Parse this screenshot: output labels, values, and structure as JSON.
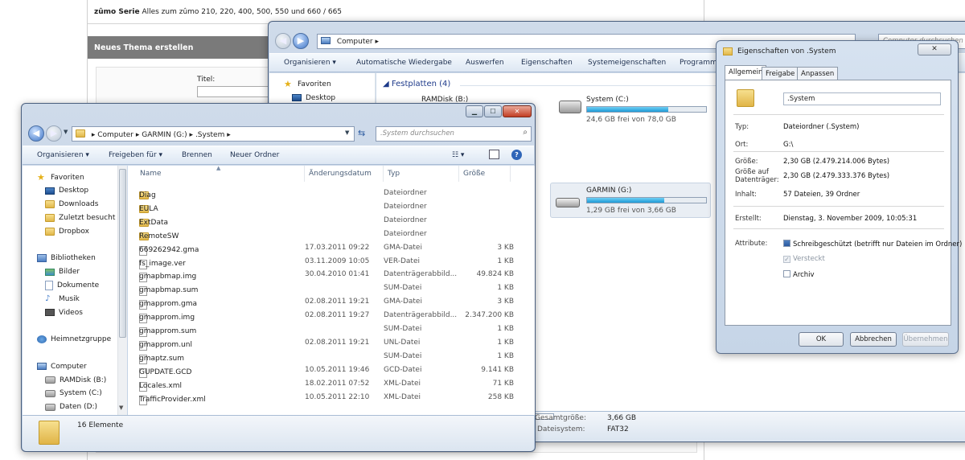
{
  "web": {
    "series_title": "zûmo Serie",
    "series_sub": "Alles zum zûmo 210, 220, 400, 500, 550 und 660 / 665",
    "thema_bar": "Neues Thema erstellen",
    "titel_label": "Titel:"
  },
  "computer_win": {
    "breadcrumb": "Computer",
    "search_placeholder": "Computer durchsuchen",
    "toolbar": [
      "Organisieren ▾",
      "Automatische Wiedergabe",
      "Auswerfen",
      "Eigenschaften",
      "Systemeigenschaften",
      "Programm"
    ],
    "nav": [
      {
        "label": "Favoriten",
        "icon": "star-icon"
      },
      {
        "label": "Desktop",
        "icon": "desktop-icon"
      }
    ],
    "group_title": "Festplatten (4)",
    "drives": [
      {
        "name": "RAMDisk (B:)",
        "free": "",
        "fill": 0.0
      },
      {
        "name": "System (C:)",
        "free": "24,6 GB frei von 78,0 GB",
        "fill": 0.68
      },
      {
        "name": "GARMIN (G:)",
        "free": "1,29 GB frei von 3,66 GB",
        "fill": 0.65
      }
    ],
    "details": {
      "gesamt_label": "Gesamtgröße:",
      "gesamt_value": "3,66 GB",
      "fs_label": "Dateisystem:",
      "fs_value": "FAT32"
    }
  },
  "main_win": {
    "breadcrumb": [
      "Computer",
      "GARMIN (G:)",
      ".System"
    ],
    "search_placeholder": ".System durchsuchen",
    "toolbar": [
      "Organisieren ▾",
      "Freigeben für ▾",
      "Brennen",
      "Neuer Ordner"
    ],
    "nav": [
      {
        "label": "Favoriten",
        "icon": "star",
        "indent": 0
      },
      {
        "label": "Desktop",
        "icon": "desk",
        "indent": 1
      },
      {
        "label": "Downloads",
        "icon": "folder",
        "indent": 1
      },
      {
        "label": "Zuletzt besucht",
        "icon": "folder",
        "indent": 1
      },
      {
        "label": "Dropbox",
        "icon": "folder",
        "indent": 1
      },
      {
        "label": "",
        "icon": "",
        "indent": 0
      },
      {
        "label": "Bibliotheken",
        "icon": "lib",
        "indent": 0
      },
      {
        "label": "Bilder",
        "icon": "pic",
        "indent": 1
      },
      {
        "label": "Dokumente",
        "icon": "doc",
        "indent": 1
      },
      {
        "label": "Musik",
        "icon": "music",
        "indent": 1
      },
      {
        "label": "Videos",
        "icon": "vid",
        "indent": 1
      },
      {
        "label": "",
        "icon": "",
        "indent": 0
      },
      {
        "label": "Heimnetzgruppe",
        "icon": "net",
        "indent": 0
      },
      {
        "label": "",
        "icon": "",
        "indent": 0
      },
      {
        "label": "Computer",
        "icon": "comp",
        "indent": 0
      },
      {
        "label": "RAMDisk (B:)",
        "icon": "disk",
        "indent": 1
      },
      {
        "label": "System (C:)",
        "icon": "disk",
        "indent": 1
      },
      {
        "label": "Daten (D:)",
        "icon": "disk",
        "indent": 1
      }
    ],
    "columns": [
      "Name",
      "Änderungsdatum",
      "Typ",
      "Größe"
    ],
    "files": [
      {
        "name": "Diag",
        "date": "",
        "type": "Dateiordner",
        "size": "",
        "folder": true
      },
      {
        "name": "EULA",
        "date": "",
        "type": "Dateiordner",
        "size": "",
        "folder": true
      },
      {
        "name": "ExtData",
        "date": "",
        "type": "Dateiordner",
        "size": "",
        "folder": true
      },
      {
        "name": "RemoteSW",
        "date": "",
        "type": "Dateiordner",
        "size": "",
        "folder": true
      },
      {
        "name": "669262942.gma",
        "date": "17.03.2011 09:22",
        "type": "GMA-Datei",
        "size": "3 KB",
        "folder": false
      },
      {
        "name": "fs_image.ver",
        "date": "03.11.2009 10:05",
        "type": "VER-Datei",
        "size": "1 KB",
        "folder": false
      },
      {
        "name": "gmapbmap.img",
        "date": "30.04.2010 01:41",
        "type": "Datenträgerabbild...",
        "size": "49.824 KB",
        "folder": false
      },
      {
        "name": "gmapbmap.sum",
        "date": "",
        "type": "SUM-Datei",
        "size": "1 KB",
        "folder": false
      },
      {
        "name": "gmapprom.gma",
        "date": "02.08.2011 19:21",
        "type": "GMA-Datei",
        "size": "3 KB",
        "folder": false
      },
      {
        "name": "gmapprom.img",
        "date": "02.08.2011 19:27",
        "type": "Datenträgerabbild...",
        "size": "2.347.200 KB",
        "folder": false
      },
      {
        "name": "gmapprom.sum",
        "date": "",
        "type": "SUM-Datei",
        "size": "1 KB",
        "folder": false
      },
      {
        "name": "gmapprom.unl",
        "date": "02.08.2011 19:21",
        "type": "UNL-Datei",
        "size": "1 KB",
        "folder": false
      },
      {
        "name": "gmaptz.sum",
        "date": "",
        "type": "SUM-Datei",
        "size": "1 KB",
        "folder": false
      },
      {
        "name": "GUPDATE.GCD",
        "date": "10.05.2011 19:46",
        "type": "GCD-Datei",
        "size": "9.141 KB",
        "folder": false
      },
      {
        "name": "Locales.xml",
        "date": "18.02.2011 07:52",
        "type": "XML-Datei",
        "size": "71 KB",
        "folder": false
      },
      {
        "name": "TrafficProvider.xml",
        "date": "10.05.2011 22:10",
        "type": "XML-Datei",
        "size": "258 KB",
        "folder": false
      }
    ],
    "status": "16 Elemente"
  },
  "props": {
    "title": "Eigenschaften von .System",
    "tabs": [
      "Allgemein",
      "Freigabe",
      "Anpassen"
    ],
    "name_value": ".System",
    "typ_label": "Typ:",
    "typ_value": "Dateiordner (.System)",
    "ort_label": "Ort:",
    "ort_value": "G:\\",
    "groesse_label": "Größe:",
    "groesse_value": "2,30 GB (2.479.214.006 Bytes)",
    "gdt_label1": "Größe auf",
    "gdt_label2": "Datenträger:",
    "gdt_value": "2,30 GB (2.479.333.376 Bytes)",
    "inhalt_label": "Inhalt:",
    "inhalt_value": "57 Dateien, 39 Ordner",
    "erstellt_label": "Erstellt:",
    "erstellt_value": "Dienstag, 3. November 2009, 10:05:31",
    "attr_label": "Attribute:",
    "attr_readonly": "Schreibgeschützt (betrifft nur Dateien im Ordner)",
    "attr_hidden": "Versteckt",
    "attr_archive": "Archiv",
    "btn_ok": "OK",
    "btn_cancel": "Abbrechen",
    "btn_apply": "Übernehmen",
    "close_glyph": "✕"
  }
}
